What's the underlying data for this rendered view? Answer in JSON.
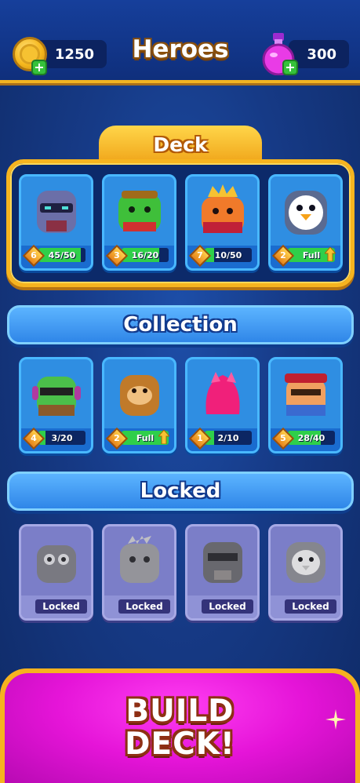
{
  "header": {
    "title": "Heroes",
    "coins": "1250",
    "gems": "300",
    "coin_icon": "coin-icon",
    "gem_icon": "potion-icon"
  },
  "deck": {
    "title": "Deck",
    "cards": [
      {
        "hero": "knight",
        "level": "6",
        "progress_text": "45/50",
        "progress": 0.9
      },
      {
        "hero": "goblin",
        "level": "3",
        "progress_text": "16/20",
        "progress": 0.8
      },
      {
        "hero": "king",
        "level": "7",
        "progress_text": "10/50",
        "progress": 0.2
      },
      {
        "hero": "penguin",
        "level": "2",
        "progress_text": "Full",
        "progress": 1.0,
        "upgrade": true
      }
    ]
  },
  "collection": {
    "title": "Collection",
    "cards": [
      {
        "hero": "zombie-headphones",
        "level": "4",
        "progress_text": "3/20",
        "progress": 0.15
      },
      {
        "hero": "monkey",
        "level": "2",
        "progress_text": "Full",
        "progress": 1.0,
        "upgrade": true
      },
      {
        "hero": "pink-blob",
        "level": "1",
        "progress_text": "2/10",
        "progress": 0.2
      },
      {
        "hero": "samurai",
        "level": "5",
        "progress_text": "28/40",
        "progress": 0.7
      }
    ]
  },
  "locked": {
    "title": "Locked",
    "cards": [
      {
        "hero": "owl",
        "label": "Locked"
      },
      {
        "hero": "dino",
        "label": "Locked"
      },
      {
        "hero": "robot-knight",
        "label": "Locked"
      },
      {
        "hero": "bird-knight",
        "label": "Locked"
      }
    ]
  },
  "build_button": {
    "line1": "BUILD",
    "line2": "DECK!"
  },
  "colors": {
    "accent_gold": "#f6b41f",
    "card_blue": "#2f8ee2",
    "progress_green": "#2fcf4a",
    "build_pink": "#e514d8",
    "locked_purple": "#7b7ec8"
  }
}
